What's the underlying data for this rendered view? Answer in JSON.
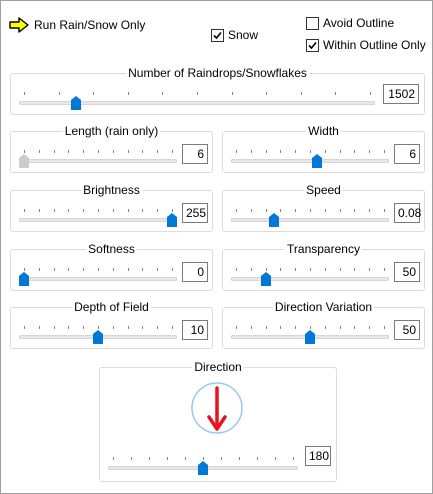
{
  "run_button": {
    "label": "Run Rain/Snow Only",
    "icon": "right-arrow-icon"
  },
  "checkboxes": {
    "snow": {
      "label": "Snow",
      "checked": true
    },
    "avoid_outline": {
      "label": "Avoid Outline",
      "checked": false
    },
    "within_outline": {
      "label": "Within Outline Only",
      "checked": true
    }
  },
  "sliders": {
    "raindrops": {
      "label": "Number of Raindrops/Snowflakes",
      "value": "1502",
      "fraction": 0.15,
      "disabled": false
    },
    "length": {
      "label": "Length (rain only)",
      "value": "6",
      "fraction": 0.0,
      "disabled": true
    },
    "width": {
      "label": "Width",
      "value": "6",
      "fraction": 0.55,
      "disabled": false
    },
    "brightness": {
      "label": "Brightness",
      "value": "255",
      "fraction": 1.0,
      "disabled": false
    },
    "speed": {
      "label": "Speed",
      "value": "0.08",
      "fraction": 0.26,
      "disabled": false
    },
    "softness": {
      "label": "Softness",
      "value": "0",
      "fraction": 0.0,
      "disabled": false
    },
    "transparency": {
      "label": "Transparency",
      "value": "50",
      "fraction": 0.2,
      "disabled": false
    },
    "depth_of_field": {
      "label": "Depth of Field",
      "value": "10",
      "fraction": 0.5,
      "disabled": false
    },
    "direction_variation": {
      "label": "Direction Variation",
      "value": "50",
      "fraction": 0.5,
      "disabled": false
    },
    "direction": {
      "label": "Direction",
      "value": "180",
      "fraction": 0.5,
      "disabled": false
    }
  },
  "direction_dial": {
    "angle_degrees": 180
  },
  "colors": {
    "thumb": "#0078d7",
    "thumb_disabled": "#cccccc",
    "arrow_red": "#e81123",
    "arrow_yellow": "#ffff00",
    "dial_circle": "#99c9ef"
  }
}
